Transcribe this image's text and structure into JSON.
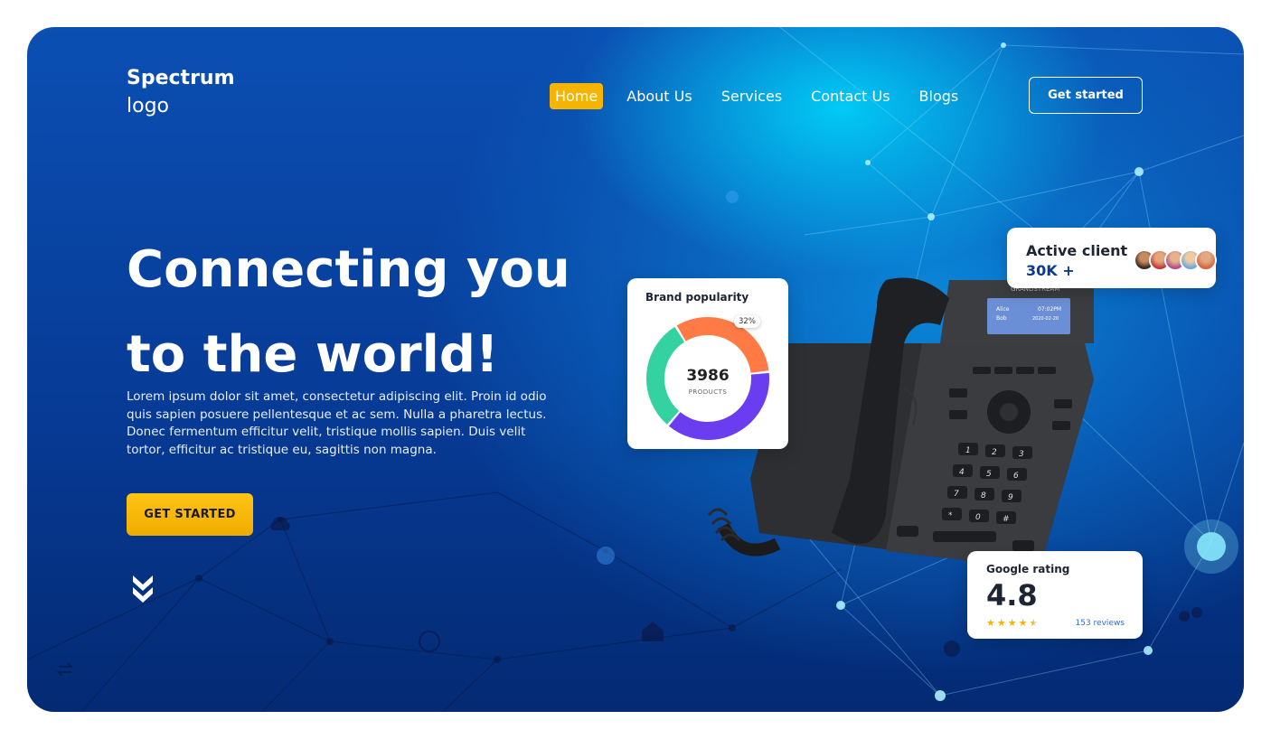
{
  "header": {
    "logo_line1": "Spectrum",
    "logo_line2": "logo",
    "nav": [
      {
        "label": "Home",
        "active": true
      },
      {
        "label": "About Us",
        "active": false
      },
      {
        "label": "Services",
        "active": false
      },
      {
        "label": "Contact Us",
        "active": false
      },
      {
        "label": "Blogs",
        "active": false
      }
    ],
    "cta_label": "Get started"
  },
  "hero": {
    "headline_line1": "Connecting you",
    "headline_line2": "to the world!",
    "description": "Lorem ipsum dolor sit amet, consectetur adipiscing elit. Proin id odio quis sapien posuere pellentesque et ac sem. Nulla a pharetra lectus. Donec fermentum efficitur velit, tristique mollis sapien. Duis velit tortor, efficitur ac tristique eu, sagittis non magna.",
    "cta_label": "GET STARTED",
    "scroll_icon": "double-chevron-down-icon"
  },
  "phone": {
    "brand": "GRANDSTREAM",
    "screen_line1": "Alice",
    "screen_line2": "Bob",
    "screen_time": "07:02PM",
    "screen_date": "2020-02-20"
  },
  "popularity_card": {
    "title": "Brand popularity",
    "value": "3986",
    "sub": "PRODUCTS",
    "pct_label": "32%"
  },
  "chart_data": {
    "type": "pie",
    "categories": [
      "orange",
      "purple",
      "green"
    ],
    "values": [
      32,
      38,
      30
    ],
    "title": "Brand popularity"
  },
  "client_card": {
    "title": "Active client",
    "value": "30K +"
  },
  "rating_card": {
    "title": "Google rating",
    "value": "4.8",
    "stars": 4.5,
    "reviews": "153 reviews"
  },
  "colors": {
    "accent": "#f5b400",
    "donut_orange": "#ff7a45",
    "donut_purple": "#6a3df0",
    "donut_green": "#33d2a0",
    "navy": "#0b3a8f"
  }
}
